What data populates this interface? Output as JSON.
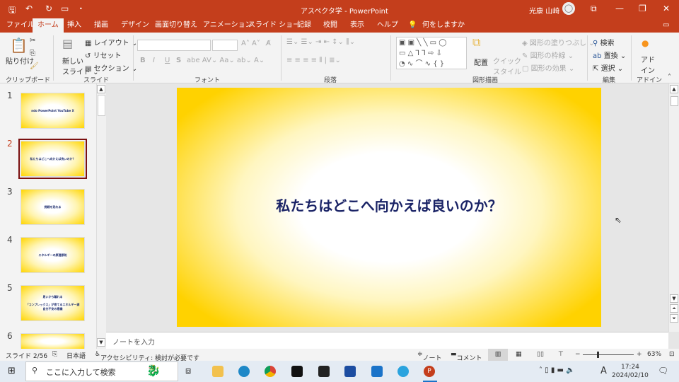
{
  "titlebar": {
    "document": "アスペクタ学",
    "separator": " - ",
    "app": "PowerPoint",
    "user": "光康 山崎"
  },
  "tabs": [
    "ファイル",
    "ホーム",
    "挿入",
    "描画",
    "デザイン",
    "画面切り替え",
    "アニメーション",
    "スライド ショー",
    "記録",
    "校閲",
    "表示",
    "ヘルプ"
  ],
  "tell_me": "何をしますか",
  "ribbon": {
    "clipboard": {
      "paste": "貼り付け",
      "label": "クリップボード"
    },
    "slides": {
      "new_slide_1": "新しい",
      "new_slide_2": "スライド",
      "layout": "レイアウト",
      "reset": "リセット",
      "section": "セクション",
      "label": "スライド"
    },
    "font": {
      "bold": "B",
      "italic": "I",
      "underline": "U",
      "strike": "S",
      "label": "フォント"
    },
    "paragraph": {
      "label": "段落"
    },
    "drawing": {
      "arrange": "配置",
      "quick_style_1": "クイック",
      "quick_style_2": "スタイル",
      "fill": "図形の塗りつぶし",
      "outline": "図形の枠線",
      "effects": "図形の効果",
      "label": "図形描画"
    },
    "editing": {
      "find": "検索",
      "replace": "置換",
      "select": "選択",
      "label": "編集"
    },
    "addins": {
      "addin_1": "アド",
      "addin_2": "イン",
      "label": "アドイン"
    }
  },
  "slides": [
    {
      "number": "1",
      "lines": [
        "ndo PowerPoint YouTube X"
      ]
    },
    {
      "number": "2",
      "lines": [
        "私たちはどこへ向かえば良いのか？"
      ],
      "selected": true
    },
    {
      "number": "3",
      "lines": [
        "挑戦を恐れる"
      ]
    },
    {
      "number": "4",
      "lines": [
        "エネルギーの原理原則"
      ]
    },
    {
      "number": "5",
      "lines": [
        "思いから離れる",
        "「コンプレックス」が育てるエネルギー源",
        "自分不安の意識"
      ]
    },
    {
      "number": "6",
      "lines": []
    }
  ],
  "current_slide": {
    "title": "私たちはどこへ向かえば良いのか？"
  },
  "notes_placeholder": "ノートを入力",
  "status": {
    "slide": "スライド 2/56",
    "language": "日本語",
    "accessibility": "アクセシビリティ: 検討が必要です",
    "notes": "ノート",
    "comments": "コメント",
    "zoom": "63%",
    "zoom_value": 63
  },
  "taskbar": {
    "search_placeholder": "ここに入力して検索",
    "time": "17:24",
    "date": "2024/02/10",
    "ime": "A"
  },
  "colors": {
    "accent": "#c43e1c",
    "slide_text": "#1a2366",
    "slide_gold": "#ffd200"
  }
}
